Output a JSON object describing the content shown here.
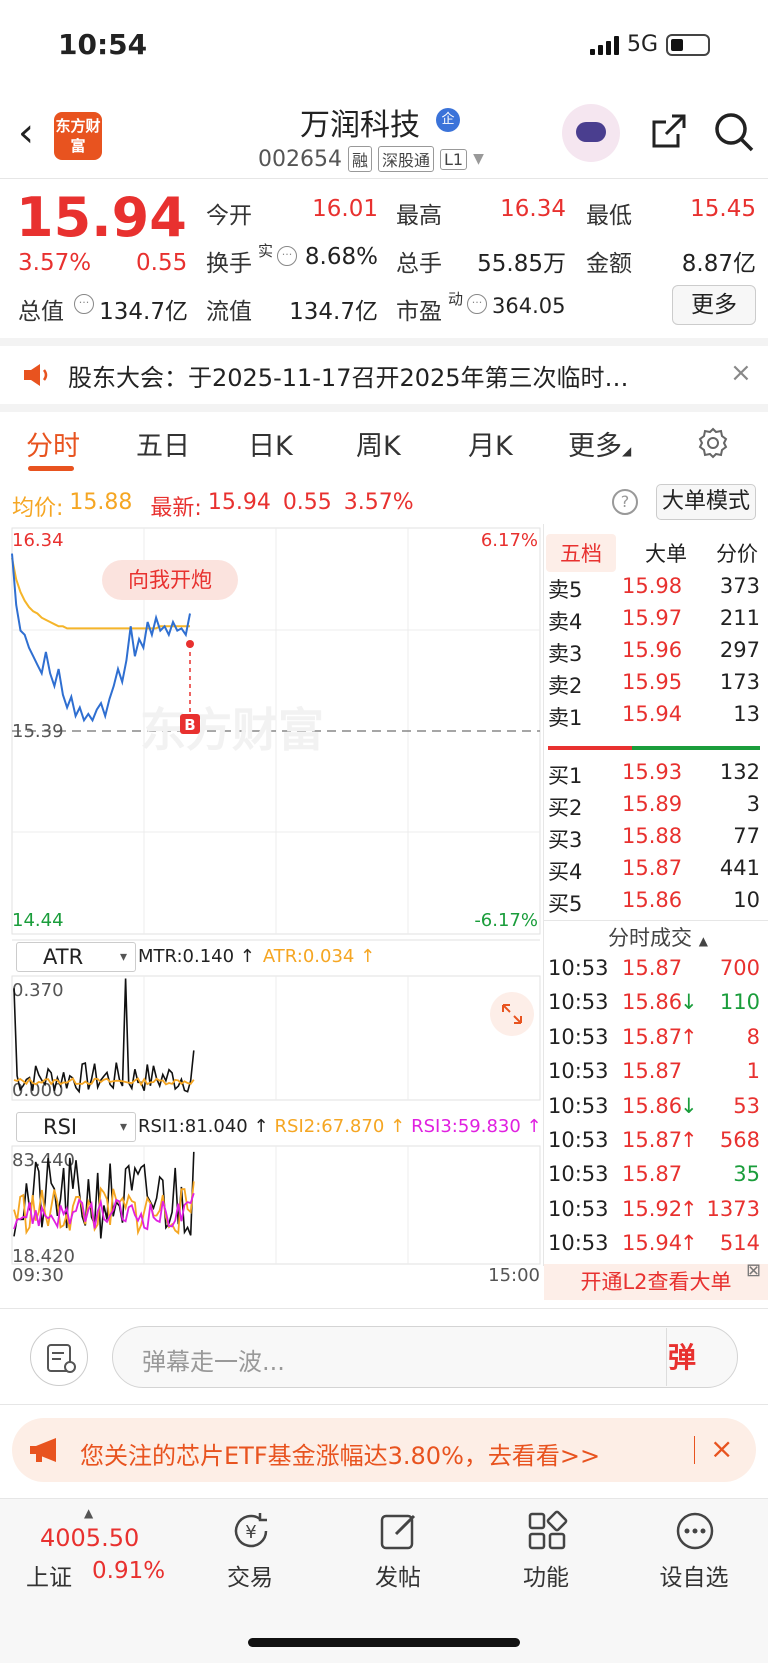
{
  "status": {
    "time": "10:54",
    "network": "5G"
  },
  "header": {
    "logo_text": "东方财富",
    "stock_name": "万润科技",
    "badge": "企",
    "code": "002654",
    "tags": [
      "融",
      "深股通",
      "L1"
    ]
  },
  "quote": {
    "price": "15.94",
    "change_pct": "3.57%",
    "change": "0.55",
    "open_label": "今开",
    "open": "16.01",
    "high_label": "最高",
    "high": "16.34",
    "low_label": "最低",
    "low": "15.45",
    "turnover_label": "换手",
    "turnover_sup": "实",
    "turnover": "8.68%",
    "volume_label": "总手",
    "volume": "55.85万",
    "amount_label": "金额",
    "amount": "8.87亿",
    "mktcap_label": "总值",
    "mktcap": "134.7亿",
    "float_label": "流值",
    "float_cap": "134.7亿",
    "pe_label": "市盈",
    "pe_sup": "动",
    "pe": "364.05",
    "more_label": "更多"
  },
  "notice": {
    "text": "股东大会：于2025-11-17召开2025年第三次临时…",
    "close": "×"
  },
  "tabs": [
    "分时",
    "五日",
    "日K",
    "周K",
    "月K",
    "更多"
  ],
  "info": {
    "avg_label": "均价:",
    "avg": "15.88",
    "last_label": "最新:",
    "last": "15.94",
    "change": "0.55",
    "pct": "3.57%",
    "help": "?",
    "big_order_btn": "大单模式"
  },
  "chart": {
    "y_max": "16.34",
    "y_mid": "15.39",
    "y_min": "14.44",
    "pct_max": "6.17%",
    "pct_min": "-6.17%",
    "bubble": "向我开炮",
    "buy_marker": "B",
    "watermark": "东方财富",
    "time_start": "09:30",
    "time_end": "15:00"
  },
  "chart_data": {
    "type": "line",
    "title": "",
    "xlabel": "",
    "ylabel": "",
    "ylim": [
      14.44,
      16.34
    ],
    "series": [
      {
        "values": [
          16.22,
          15.98,
          15.86,
          15.84,
          15.78,
          15.74,
          15.7,
          15.66,
          15.76,
          15.66,
          15.6,
          15.68,
          15.56,
          15.5,
          15.55,
          15.46,
          15.5,
          15.44,
          15.47,
          15.44,
          15.49,
          15.52,
          15.46,
          15.54,
          15.6,
          15.68,
          15.62,
          15.72,
          15.88,
          15.74,
          15.82,
          15.78,
          15.9,
          15.84,
          15.92,
          15.86,
          15.88,
          15.84,
          15.9,
          15.86,
          15.87,
          15.84,
          15.94
        ]
      },
      {
        "values": [
          16.2,
          16.1,
          16.04,
          16.0,
          15.97,
          15.95,
          15.94,
          15.92,
          15.91,
          15.9,
          15.89,
          15.88,
          15.88,
          15.87,
          15.87,
          15.87,
          15.87,
          15.87,
          15.87,
          15.87,
          15.87,
          15.87,
          15.87,
          15.87,
          15.87,
          15.87,
          15.87,
          15.87,
          15.87,
          15.87,
          15.87,
          15.87,
          15.87,
          15.87,
          15.87,
          15.88,
          15.88,
          15.88,
          15.88,
          15.88,
          15.88,
          15.88,
          15.88
        ]
      }
    ]
  },
  "orderbook": {
    "tabs": [
      "五档",
      "大单",
      "分价"
    ],
    "asks": [
      {
        "label": "卖5",
        "price": "15.98",
        "vol": "373"
      },
      {
        "label": "卖4",
        "price": "15.97",
        "vol": "211"
      },
      {
        "label": "卖3",
        "price": "15.96",
        "vol": "297"
      },
      {
        "label": "卖2",
        "price": "15.95",
        "vol": "173"
      },
      {
        "label": "卖1",
        "price": "15.94",
        "vol": "13"
      }
    ],
    "bids": [
      {
        "label": "买1",
        "price": "15.93",
        "vol": "132"
      },
      {
        "label": "买2",
        "price": "15.89",
        "vol": "3"
      },
      {
        "label": "买3",
        "price": "15.88",
        "vol": "77"
      },
      {
        "label": "买4",
        "price": "15.87",
        "vol": "441"
      },
      {
        "label": "买5",
        "price": "15.86",
        "vol": "10"
      }
    ],
    "trades_title": "分时成交",
    "trades": [
      {
        "time": "10:53",
        "price": "15.87",
        "arrow": "",
        "vol": "700",
        "dir": "red"
      },
      {
        "time": "10:53",
        "price": "15.86",
        "arrow": "↓",
        "vol": "110",
        "dir": "green"
      },
      {
        "time": "10:53",
        "price": "15.87",
        "arrow": "↑",
        "vol": "8",
        "dir": "red"
      },
      {
        "time": "10:53",
        "price": "15.87",
        "arrow": "",
        "vol": "1",
        "dir": "red"
      },
      {
        "time": "10:53",
        "price": "15.86",
        "arrow": "↓",
        "vol": "53",
        "dir": "red"
      },
      {
        "time": "10:53",
        "price": "15.87",
        "arrow": "↑",
        "vol": "568",
        "dir": "red"
      },
      {
        "time": "10:53",
        "price": "15.87",
        "arrow": "",
        "vol": "35",
        "dir": "green"
      },
      {
        "time": "10:53",
        "price": "15.92",
        "arrow": "↑",
        "vol": "1373",
        "dir": "red"
      },
      {
        "time": "10:53",
        "price": "15.94",
        "arrow": "↑",
        "vol": "514",
        "dir": "red"
      }
    ],
    "l2_text": "开通L2查看大单"
  },
  "atr": {
    "select": "ATR",
    "mtr": "MTR:0.140 ↑",
    "atr": "ATR:0.034 ↑",
    "max": "0.370",
    "min": "0.000"
  },
  "rsi": {
    "select": "RSI",
    "rsi1": "RSI1:81.040 ↑",
    "rsi2": "RSI2:67.870 ↑",
    "rsi3": "RSI3:59.830 ↑",
    "max": "83.440",
    "min": "18.420"
  },
  "comment": {
    "placeholder": "弹幕走一波...",
    "danmaku": "弹"
  },
  "promo": {
    "text": "您关注的芯片ETF基金涨幅达3.80%，去看看>>",
    "close": "×"
  },
  "bottom_nav": {
    "index_value": "4005.50",
    "index_name": "上证",
    "index_pct": "0.91%",
    "items": [
      "交易",
      "发帖",
      "功能",
      "设自选"
    ]
  },
  "colors": {
    "up": "#e8312f",
    "down": "#1a9d3b",
    "brand": "#e8531f",
    "price_line": "#2f6fd1",
    "avg_line": "#f5b52a"
  }
}
